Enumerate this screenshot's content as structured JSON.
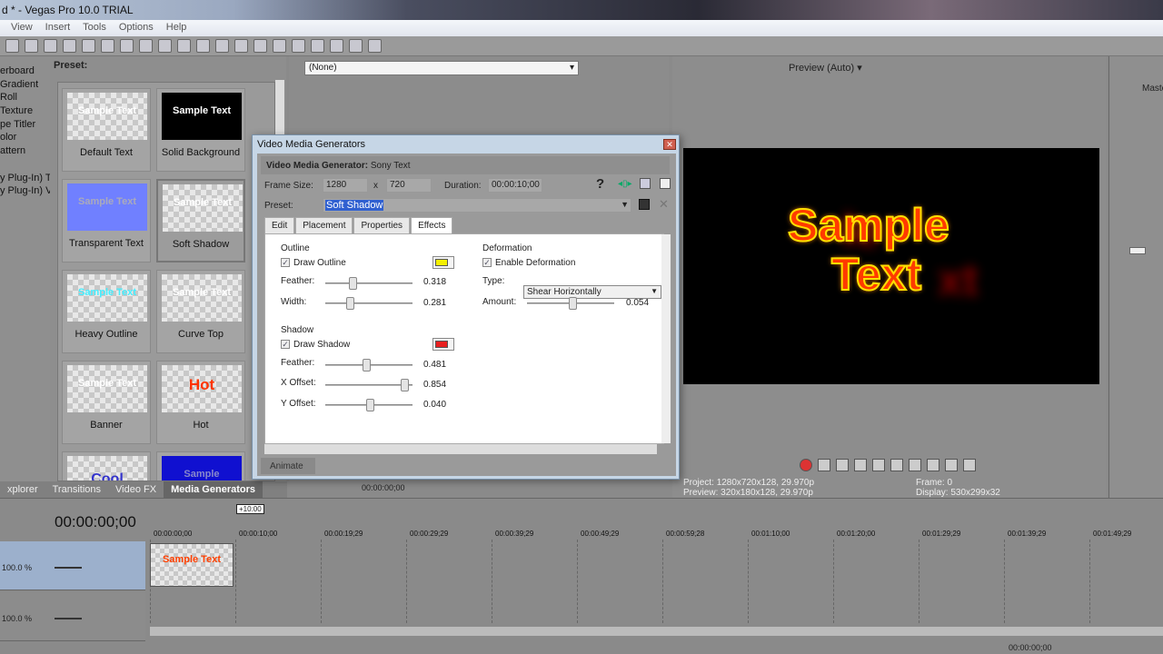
{
  "window": {
    "title": "d * - Vegas Pro 10.0 TRIAL"
  },
  "menu": [
    "View",
    "Insert",
    "Tools",
    "Options",
    "Help"
  ],
  "left_list": [
    "erboard",
    "Gradient",
    "Roll",
    "Texture",
    "pe Titler",
    "olor",
    "attern",
    "",
    "y Plug-In) T",
    "y Plug-In) V"
  ],
  "presets": {
    "label": "Preset:",
    "items": [
      {
        "name": "Default Text",
        "thumb": "Sample Text"
      },
      {
        "name": "Solid Background",
        "thumb": "Sample Text"
      },
      {
        "name": "Transparent Text",
        "thumb": "Sample Text"
      },
      {
        "name": "Soft Shadow",
        "thumb": "Sample Text"
      },
      {
        "name": "Heavy Outline",
        "thumb": "Sample Text"
      },
      {
        "name": "Curve Top",
        "thumb": "Sample Text"
      },
      {
        "name": "Banner",
        "thumb": "Sample Text"
      },
      {
        "name": "Hot",
        "thumb": "Hot"
      },
      {
        "name": "",
        "thumb": "Cool"
      },
      {
        "name": "",
        "thumb": "Sample"
      }
    ]
  },
  "trimmer": {
    "selection": "(None)",
    "timecode": "00:00:00;00"
  },
  "preview": {
    "mode": "Preview (Auto)",
    "text_line1": "Sample",
    "text_line2": "Text",
    "project_label": "Project:",
    "project": "1280x720x128, 29.970p",
    "preview_label": "Preview:",
    "preview_val": "320x180x128, 29.970p",
    "frame_label": "Frame:",
    "frame": "0",
    "display_label": "Display:",
    "display": "530x299x32"
  },
  "master": {
    "label": "Maste"
  },
  "tabs": [
    {
      "label": "xplorer"
    },
    {
      "label": "Transitions"
    },
    {
      "label": "Video FX"
    },
    {
      "label": "Media Generators",
      "active": true
    }
  ],
  "timeline": {
    "timecode": "00:00:00;00",
    "length_badge": "+10:00",
    "ruler": [
      "00:00:00;00",
      "00:00:10;00",
      "00:00:19;29",
      "00:00:29;29",
      "00:00:39;29",
      "00:00:49;29",
      "00:00:59;28",
      "00:01:10;00",
      "00:01:20;00",
      "00:01:29;29",
      "00:01:39;29",
      "00:01:49;29"
    ],
    "tracks": [
      {
        "level": "100.0 %"
      },
      {
        "level": "100.0 %"
      }
    ],
    "clip_text": "Sample Text",
    "bottom_timecode": "00:00:00;00"
  },
  "dialog": {
    "title": "Video Media Generators",
    "generator_label": "Video Media Generator:",
    "generator": "Sony Text",
    "frame_size_label": "Frame Size:",
    "width": "1280",
    "x": "x",
    "height": "720",
    "duration_label": "Duration:",
    "duration": "00:00:10;00",
    "preset_label": "Preset:",
    "preset": "Soft Shadow",
    "tabs": [
      "Edit",
      "Placement",
      "Properties",
      "Effects"
    ],
    "active_tab": "Effects",
    "outline": {
      "heading": "Outline",
      "draw_label": "Draw Outline",
      "checked": true,
      "color": "#f5f000",
      "feather_label": "Feather:",
      "feather": "0.318",
      "width_label": "Width:",
      "width": "0.281"
    },
    "shadow": {
      "heading": "Shadow",
      "draw_label": "Draw Shadow",
      "checked": true,
      "color": "#e82020",
      "feather_label": "Feather:",
      "feather": "0.481",
      "xoff_label": "X Offset:",
      "xoff": "0.854",
      "yoff_label": "Y Offset:",
      "yoff": "0.040"
    },
    "deformation": {
      "heading": "Deformation",
      "enable_label": "Enable Deformation",
      "checked": true,
      "type_label": "Type:",
      "type": "Shear Horizontally",
      "amount_label": "Amount:",
      "amount": "0.054"
    },
    "animate_label": "Animate"
  }
}
